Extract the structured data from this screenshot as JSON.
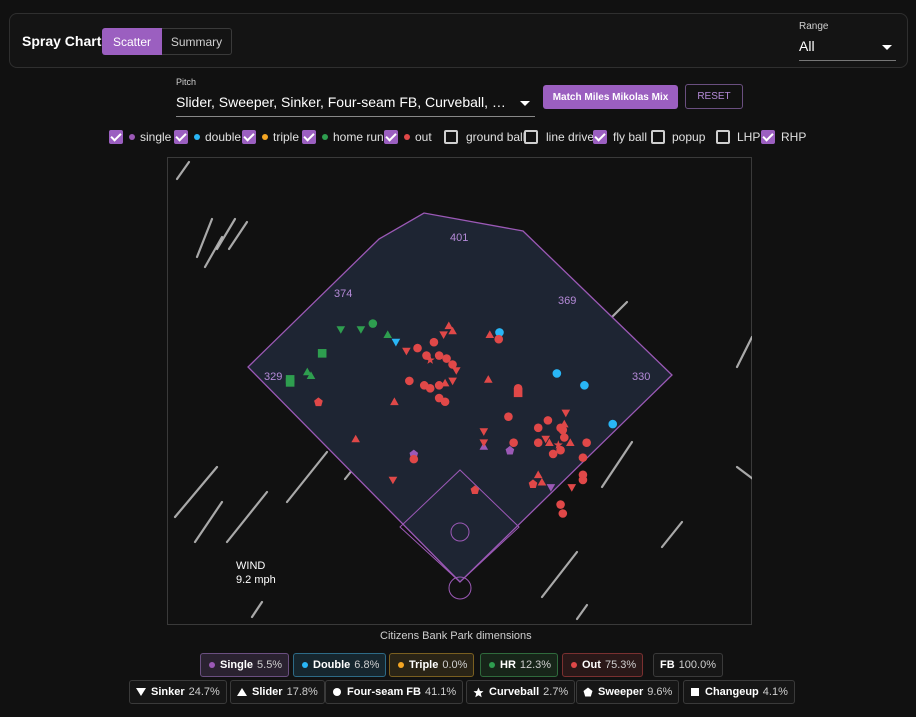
{
  "header": {
    "title": "Spray Chart",
    "tabs": [
      "Scatter",
      "Summary"
    ],
    "active_tab": "Scatter"
  },
  "range": {
    "label": "Range",
    "value": "All"
  },
  "pitch": {
    "label": "Pitch",
    "value": "Slider, Sweeper, Sinker, Four-seam FB, Curveball, Changeup"
  },
  "buttons": {
    "match": "Match Miles Mikolas Mix",
    "reset": "RESET"
  },
  "filters": [
    {
      "label": "single",
      "checked": true,
      "color": "#9b59b6"
    },
    {
      "label": "double",
      "checked": true,
      "color": "#29b6f6"
    },
    {
      "label": "triple",
      "checked": true,
      "color": "#f5a623"
    },
    {
      "label": "home run",
      "checked": true,
      "color": "#2e9e4f"
    },
    {
      "label": "out",
      "checked": true,
      "color": "#e04848"
    },
    {
      "label": "ground ball",
      "checked": false
    },
    {
      "label": "line drive",
      "checked": false
    },
    {
      "label": "fly ball",
      "checked": true
    },
    {
      "label": "popup",
      "checked": false
    },
    {
      "label": "LHP",
      "checked": false
    },
    {
      "label": "RHP",
      "checked": true
    }
  ],
  "field": {
    "dimensions": {
      "left": "329",
      "left_center": "374",
      "center": "401",
      "right_center": "369",
      "right": "330"
    },
    "caption": "Citizens Bank Park dimensions",
    "wind_label": "WIND",
    "wind_speed": "9.2 mph",
    "outline_color": "#9b59b6",
    "fill_color": "#1e2533"
  },
  "result_legend": [
    {
      "label": "Single",
      "pct": "5.5%",
      "color": "#9b59b6",
      "bg": "#2a2230",
      "border": "#6a4f80"
    },
    {
      "label": "Double",
      "pct": "6.8%",
      "color": "#29b6f6",
      "bg": "#16262e",
      "border": "#2d6a86"
    },
    {
      "label": "Triple",
      "pct": "0.0%",
      "color": "#f5a623",
      "bg": "#2a2416",
      "border": "#7a5f20"
    },
    {
      "label": "HR",
      "pct": "12.3%",
      "color": "#2e9e4f",
      "bg": "#172519",
      "border": "#2f6a3c"
    },
    {
      "label": "Out",
      "pct": "75.3%",
      "color": "#e04848",
      "bg": "#2a1818",
      "border": "#7a3030"
    }
  ],
  "fb": {
    "label": "FB",
    "pct": "100.0%"
  },
  "pitch_legend": [
    {
      "label": "Sinker",
      "pct": "24.7%",
      "shape": "triangle-down"
    },
    {
      "label": "Slider",
      "pct": "17.8%",
      "shape": "triangle-up"
    },
    {
      "label": "Four-seam FB",
      "pct": "41.1%",
      "shape": "circle"
    },
    {
      "label": "Curveball",
      "pct": "2.7%",
      "shape": "star"
    },
    {
      "label": "Sweeper",
      "pct": "9.6%",
      "shape": "pentagon"
    },
    {
      "label": "Changeup",
      "pct": "4.1%",
      "shape": "square"
    }
  ],
  "chart_data": {
    "type": "scatter",
    "title": "",
    "xlabel": "",
    "ylabel": "",
    "grid": false,
    "note": "Batted-ball landing spots plotted on the park; x,y are field coordinates in feet from home plate (x = toward first-base side positive).",
    "series": [
      {
        "name": "single",
        "color": "#9b59b6",
        "points": [
          {
            "x": -62,
            "y": 180,
            "pitch": "sweeper"
          },
          {
            "x": 32,
            "y": 190,
            "pitch": "slider"
          },
          {
            "x": 67,
            "y": 185,
            "pitch": "sweeper"
          },
          {
            "x": 122,
            "y": 135,
            "pitch": "sinker"
          }
        ]
      },
      {
        "name": "double",
        "color": "#29b6f6",
        "points": [
          {
            "x": -86,
            "y": 330,
            "pitch": "sinker"
          },
          {
            "x": 53,
            "y": 343,
            "pitch": "four-seam"
          },
          {
            "x": 130,
            "y": 288,
            "pitch": "four-seam"
          },
          {
            "x": 167,
            "y": 272,
            "pitch": "four-seam"
          },
          {
            "x": 205,
            "y": 220,
            "pitch": "four-seam"
          }
        ]
      },
      {
        "name": "home run",
        "color": "#2e9e4f",
        "points": [
          {
            "x": -160,
            "y": 347,
            "pitch": "sinker"
          },
          {
            "x": -133,
            "y": 347,
            "pitch": "sinker"
          },
          {
            "x": -117,
            "y": 355,
            "pitch": "four-seam"
          },
          {
            "x": -97,
            "y": 340,
            "pitch": "slider"
          },
          {
            "x": -185,
            "y": 315,
            "pitch": "changeup"
          },
          {
            "x": -205,
            "y": 290,
            "pitch": "slider"
          },
          {
            "x": -200,
            "y": 285,
            "pitch": "slider"
          },
          {
            "x": -228,
            "y": 280,
            "pitch": "changeup"
          },
          {
            "x": -228,
            "y": 276,
            "pitch": "changeup"
          }
        ]
      },
      {
        "name": "out",
        "color": "#e04848",
        "points": [
          {
            "x": -190,
            "y": 250,
            "pitch": "sweeper"
          },
          {
            "x": -140,
            "y": 200,
            "pitch": "slider"
          },
          {
            "x": -90,
            "y": 145,
            "pitch": "sinker"
          },
          {
            "x": -62,
            "y": 173,
            "pitch": "four-seam"
          },
          {
            "x": -72,
            "y": 318,
            "pitch": "sinker"
          },
          {
            "x": -57,
            "y": 322,
            "pitch": "four-seam"
          },
          {
            "x": -45,
            "y": 312,
            "pitch": "four-seam"
          },
          {
            "x": -40,
            "y": 306,
            "pitch": "curveball"
          },
          {
            "x": -35,
            "y": 330,
            "pitch": "four-seam"
          },
          {
            "x": -28,
            "y": 312,
            "pitch": "four-seam"
          },
          {
            "x": -22,
            "y": 340,
            "pitch": "sinker"
          },
          {
            "x": -15,
            "y": 352,
            "pitch": "slider"
          },
          {
            "x": -10,
            "y": 345,
            "pitch": "slider"
          },
          {
            "x": -18,
            "y": 308,
            "pitch": "four-seam"
          },
          {
            "x": -10,
            "y": 300,
            "pitch": "four-seam"
          },
          {
            "x": -5,
            "y": 292,
            "pitch": "sinker"
          },
          {
            "x": -88,
            "y": 250,
            "pitch": "slider"
          },
          {
            "x": -68,
            "y": 278,
            "pitch": "four-seam"
          },
          {
            "x": -48,
            "y": 272,
            "pitch": "four-seam"
          },
          {
            "x": -40,
            "y": 268,
            "pitch": "four-seam"
          },
          {
            "x": -28,
            "y": 272,
            "pitch": "four-seam"
          },
          {
            "x": -20,
            "y": 275,
            "pitch": "slider"
          },
          {
            "x": -10,
            "y": 278,
            "pitch": "sinker"
          },
          {
            "x": -20,
            "y": 250,
            "pitch": "four-seam"
          },
          {
            "x": -28,
            "y": 255,
            "pitch": "four-seam"
          },
          {
            "x": 40,
            "y": 340,
            "pitch": "slider"
          },
          {
            "x": 52,
            "y": 334,
            "pitch": "four-seam"
          },
          {
            "x": 38,
            "y": 280,
            "pitch": "slider"
          },
          {
            "x": 78,
            "y": 262,
            "pitch": "changeup"
          },
          {
            "x": 78,
            "y": 268,
            "pitch": "four-seam"
          },
          {
            "x": 65,
            "y": 230,
            "pitch": "four-seam"
          },
          {
            "x": 32,
            "y": 210,
            "pitch": "sinker"
          },
          {
            "x": 32,
            "y": 195,
            "pitch": "sinker"
          },
          {
            "x": 72,
            "y": 195,
            "pitch": "four-seam"
          },
          {
            "x": 105,
            "y": 215,
            "pitch": "four-seam"
          },
          {
            "x": 105,
            "y": 195,
            "pitch": "four-seam"
          },
          {
            "x": 115,
            "y": 200,
            "pitch": "sinker"
          },
          {
            "x": 118,
            "y": 225,
            "pitch": "four-seam"
          },
          {
            "x": 135,
            "y": 215,
            "pitch": "four-seam"
          },
          {
            "x": 138,
            "y": 212,
            "pitch": "four-seam"
          },
          {
            "x": 140,
            "y": 220,
            "pitch": "slider"
          },
          {
            "x": 142,
            "y": 235,
            "pitch": "sinker"
          },
          {
            "x": 140,
            "y": 202,
            "pitch": "four-seam"
          },
          {
            "x": 132,
            "y": 192,
            "pitch": "curveball"
          },
          {
            "x": 135,
            "y": 185,
            "pitch": "four-seam"
          },
          {
            "x": 148,
            "y": 195,
            "pitch": "slider"
          },
          {
            "x": 125,
            "y": 180,
            "pitch": "four-seam"
          },
          {
            "x": 120,
            "y": 195,
            "pitch": "slider"
          },
          {
            "x": 165,
            "y": 175,
            "pitch": "four-seam"
          },
          {
            "x": 170,
            "y": 195,
            "pitch": "four-seam"
          },
          {
            "x": 165,
            "y": 152,
            "pitch": "four-seam"
          },
          {
            "x": 165,
            "y": 145,
            "pitch": "four-seam"
          },
          {
            "x": 150,
            "y": 135,
            "pitch": "sinker"
          },
          {
            "x": 105,
            "y": 152,
            "pitch": "slider"
          },
          {
            "x": 98,
            "y": 140,
            "pitch": "sweeper"
          },
          {
            "x": 110,
            "y": 142,
            "pitch": "slider"
          },
          {
            "x": 135,
            "y": 112,
            "pitch": "four-seam"
          },
          {
            "x": 138,
            "y": 100,
            "pitch": "four-seam"
          },
          {
            "x": 20,
            "y": 132,
            "pitch": "sweeper"
          }
        ]
      }
    ]
  }
}
